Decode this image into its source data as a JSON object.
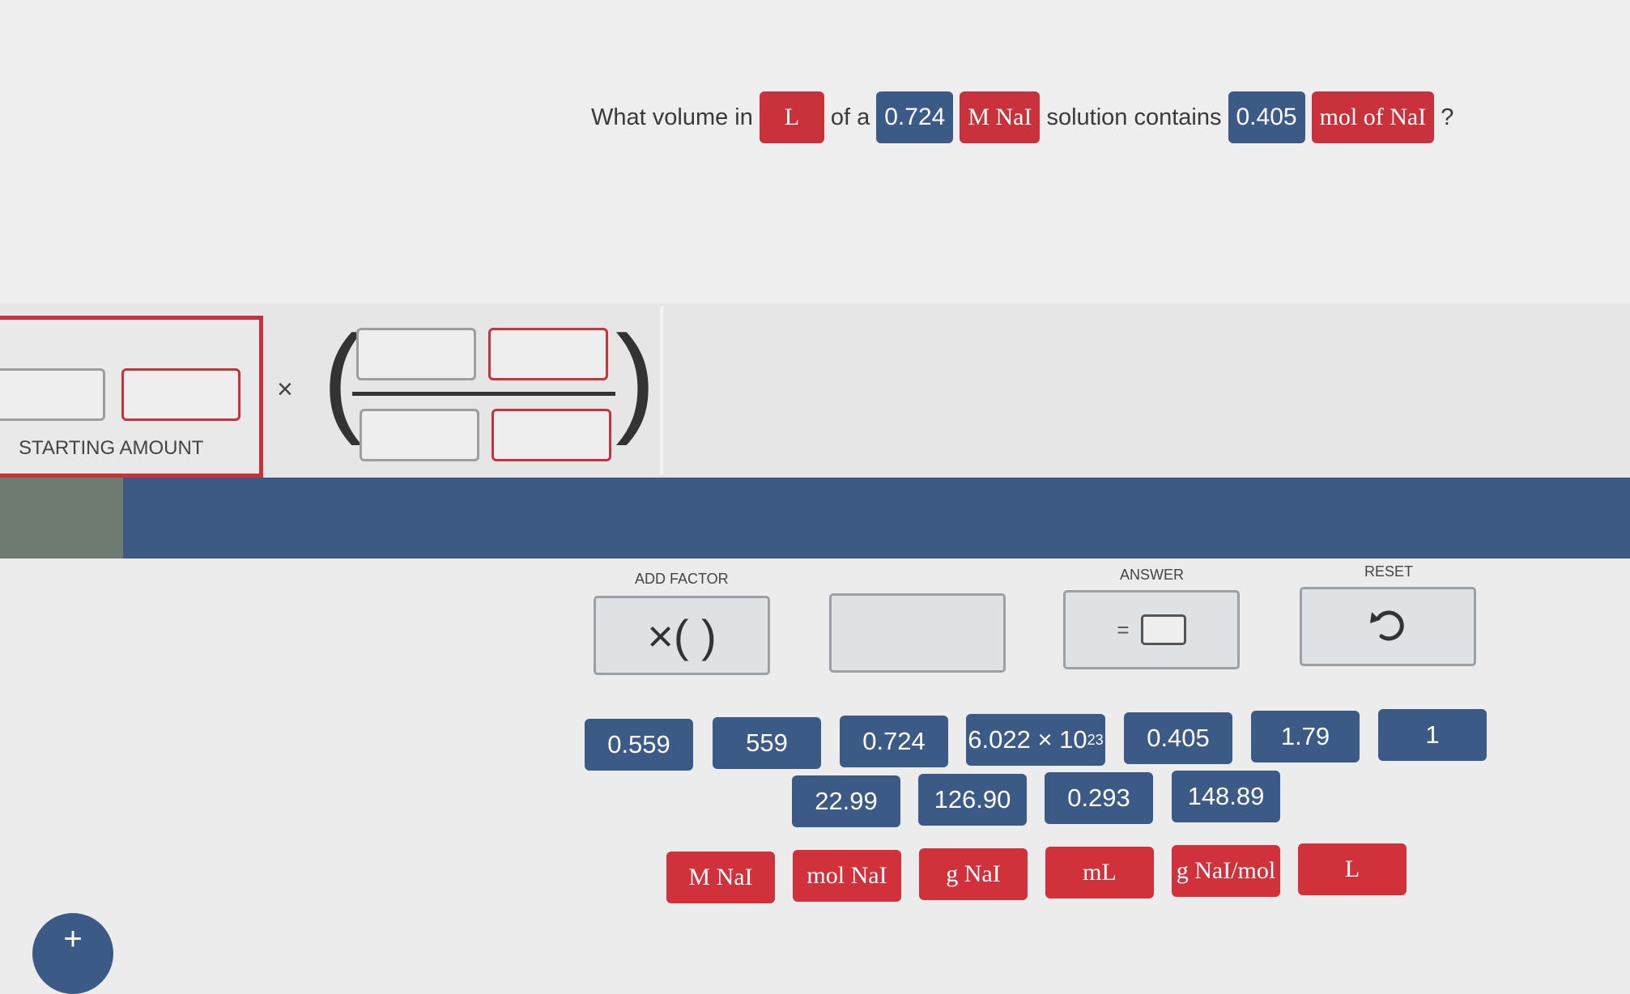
{
  "question": {
    "prefix": "What volume in",
    "unit_target": "L",
    "of_a": "of a",
    "molarity_value": "0.724",
    "molarity_unit": "M NaI",
    "solution_contains": "solution contains",
    "amount_value": "0.405",
    "amount_unit": "mol of NaI",
    "qmark": "?"
  },
  "workspace": {
    "starting_amount_label": "STARTING AMOUNT",
    "times_symbol": "×"
  },
  "tools": {
    "add_factor_label": "ADD FACTOR",
    "add_factor_symbol": "×( )",
    "answer_label": "ANSWER",
    "answer_equals": "=",
    "reset_label": "RESET",
    "reset_icon": "undo-arrow-icon"
  },
  "number_tiles_row1": [
    "0.559",
    "559",
    "0.724",
    "6.022 × 10",
    "0.405",
    "1.79",
    "1"
  ],
  "sci_exponent": "23",
  "number_tiles_row2": [
    "22.99",
    "126.90",
    "0.293",
    "148.89"
  ],
  "unit_tiles": [
    "M NaI",
    "mol NaI",
    "g NaI",
    "mL",
    "g NaI/mol",
    "L"
  ],
  "colors": {
    "blue": "#3b5a85",
    "red": "#c9323a"
  }
}
